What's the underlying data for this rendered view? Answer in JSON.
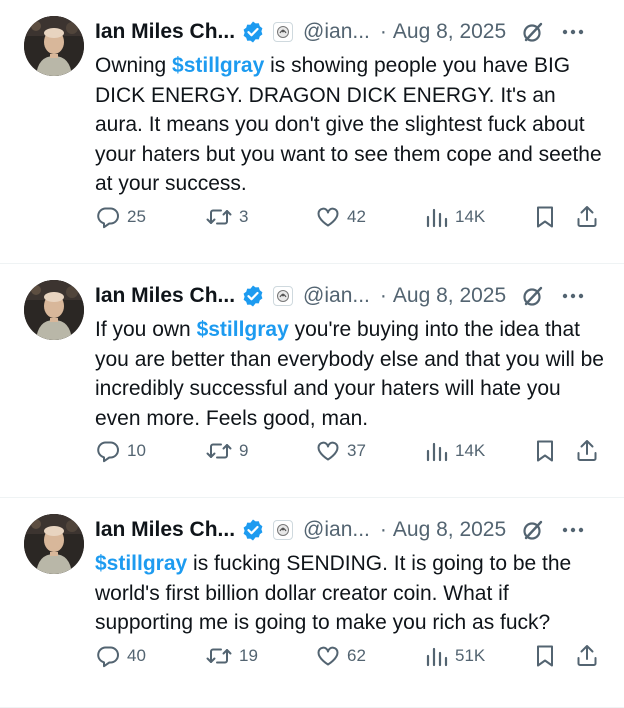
{
  "colors": {
    "accent": "#1d9bf0",
    "secondary_text": "#536471",
    "primary_text": "#0f1419",
    "divider": "#eff3f4"
  },
  "icons": [
    "verified-badge-icon",
    "affiliate-badge-icon",
    "grok-icon",
    "more-icon",
    "reply-icon",
    "repost-icon",
    "like-icon",
    "views-icon",
    "bookmark-icon",
    "share-icon"
  ],
  "tweets": [
    {
      "author_name": "Ian Miles Ch...",
      "handle": "@ian...",
      "separator": "·",
      "date": "Aug 8, 2025",
      "cashtag": "$stillgray",
      "text_before": "Owning ",
      "text_after": " is showing people you have BIG DICK ENERGY. DRAGON DICK ENERGY. It's an aura. It means you don't give the slightest fuck about your haters but you want to see them cope and seethe at your success.",
      "replies": "25",
      "reposts": "3",
      "likes": "42",
      "views": "14K"
    },
    {
      "author_name": "Ian Miles Ch...",
      "handle": "@ian...",
      "separator": "·",
      "date": "Aug 8, 2025",
      "cashtag": "$stillgray",
      "text_before": "If you own ",
      "text_after": " you're buying into the idea that you are better than everybody else and that you will be incredibly successful and your haters will hate you even more. Feels good, man.",
      "replies": "10",
      "reposts": "9",
      "likes": "37",
      "views": "14K"
    },
    {
      "author_name": "Ian Miles Ch...",
      "handle": "@ian...",
      "separator": "·",
      "date": "Aug 8, 2025",
      "cashtag": "$stillgray",
      "text_before": "",
      "text_after": " is fucking SENDING. It is going to be the world's first billion dollar creator coin. What if supporting me is going to make you rich as fuck?",
      "replies": "40",
      "reposts": "19",
      "likes": "62",
      "views": "51K"
    }
  ]
}
